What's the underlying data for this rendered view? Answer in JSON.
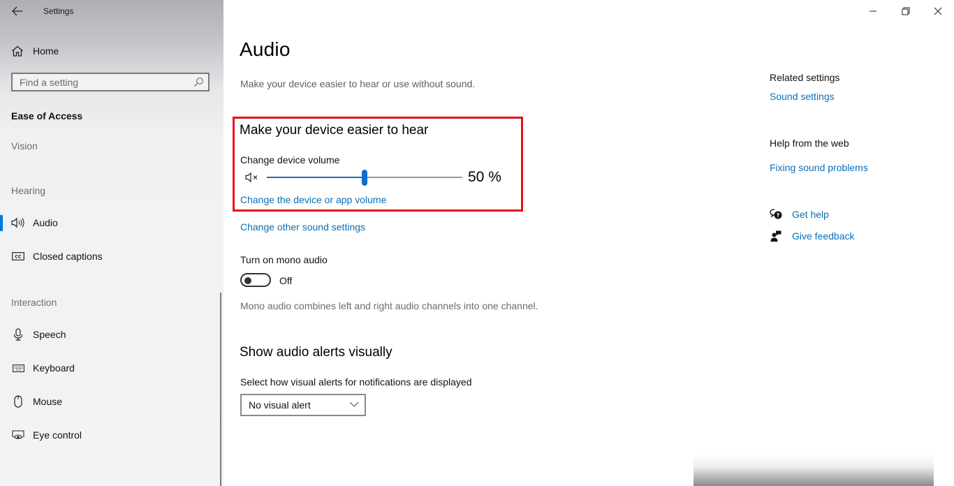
{
  "window": {
    "title": "Settings",
    "controls": {
      "minimize": "minimize-icon",
      "restore": "restore-icon",
      "close": "close-icon"
    }
  },
  "sidebar": {
    "home_label": "Home",
    "search_placeholder": "Find a setting",
    "search_value": "",
    "section_title": "Ease of Access",
    "groups": {
      "vision": "Vision",
      "hearing": "Hearing",
      "interaction": "Interaction"
    },
    "items": [
      {
        "label": "Audio",
        "icon": "speaker-icon",
        "selected": true
      },
      {
        "label": "Closed captions",
        "icon": "closed-captions-icon",
        "selected": false
      },
      {
        "label": "Speech",
        "icon": "microphone-icon",
        "selected": false
      },
      {
        "label": "Keyboard",
        "icon": "keyboard-icon",
        "selected": false
      },
      {
        "label": "Mouse",
        "icon": "mouse-icon",
        "selected": false
      },
      {
        "label": "Eye control",
        "icon": "eye-control-icon",
        "selected": false
      }
    ],
    "accent_color": "#0078d7"
  },
  "main": {
    "title": "Audio",
    "description": "Make your device easier to hear or use without sound.",
    "hear_section": {
      "title": "Make your device easier to hear",
      "volume_label": "Change device volume",
      "volume_percent": 50,
      "volume_display": "50 %",
      "app_volume_link": "Change the device or app volume",
      "highlight_color": "#e3121b"
    },
    "other_sound_link": "Change other sound settings",
    "mono": {
      "label": "Turn on mono audio",
      "state": "Off",
      "description": "Mono audio combines left and right audio channels into one channel."
    },
    "visual_alerts": {
      "title": "Show audio alerts visually",
      "label": "Select how visual alerts for notifications are displayed",
      "selected": "No visual alert"
    },
    "link_color": "#0a6fb8"
  },
  "right": {
    "related_header": "Related settings",
    "related_link": "Sound settings",
    "web_header": "Help from the web",
    "web_link": "Fixing sound problems",
    "get_help": "Get help",
    "give_feedback": "Give feedback"
  }
}
